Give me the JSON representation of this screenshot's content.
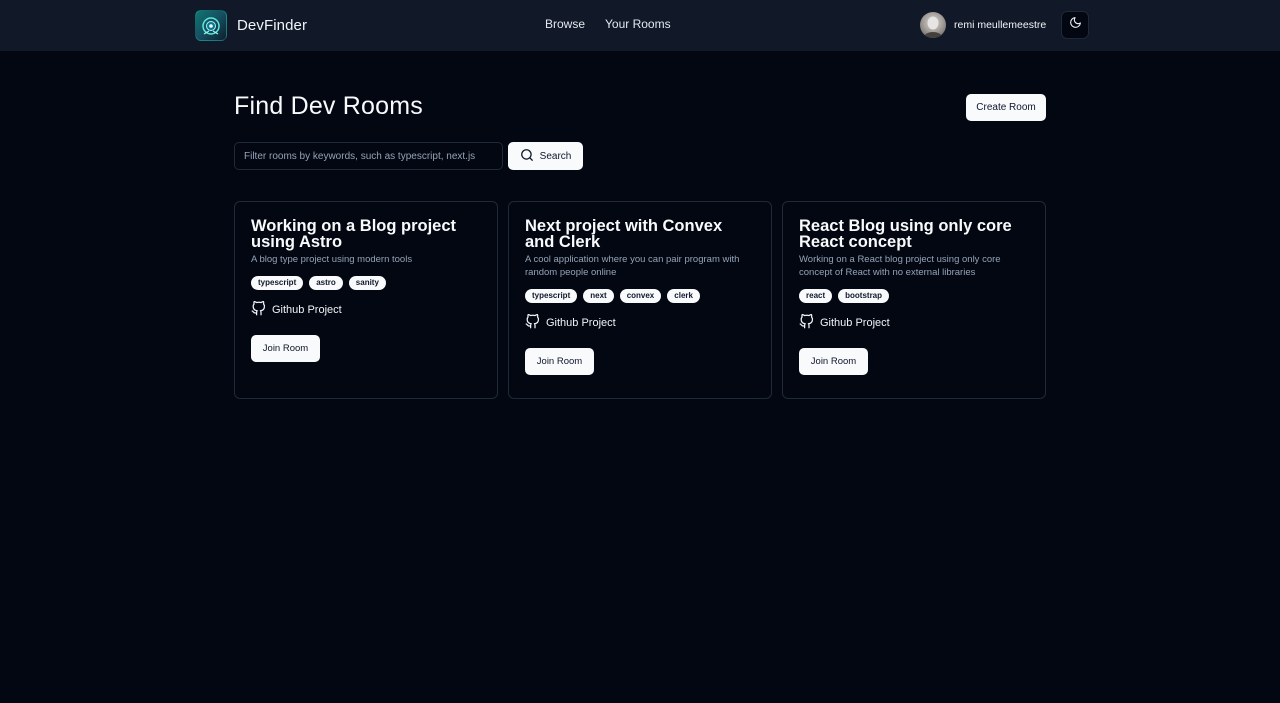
{
  "header": {
    "brand": "DevFinder",
    "nav": [
      {
        "label": "Browse"
      },
      {
        "label": "Your Rooms"
      }
    ],
    "user_name": "remi meullemeestre"
  },
  "main": {
    "title": "Find Dev Rooms",
    "create_label": "Create Room",
    "search_placeholder": "Filter rooms by keywords, such as typescript, next.js",
    "search_value": "",
    "search_label": "Search"
  },
  "rooms": [
    {
      "title": "Working on a Blog project using Astro",
      "description": "A blog type project using modern tools",
      "tags": [
        "typescript",
        "astro",
        "sanity"
      ],
      "link_label": "Github Project",
      "join_label": "Join Room"
    },
    {
      "title": "Next project with Convex and Clerk",
      "description": "A cool application where you can pair program with random people online",
      "tags": [
        "typescript",
        "next",
        "convex",
        "clerk"
      ],
      "link_label": "Github Project",
      "join_label": "Join Room"
    },
    {
      "title": "React Blog using only core React concept",
      "description": "Working on a React blog project using only core concept of React with no external libraries",
      "tags": [
        "react",
        "bootstrap"
      ],
      "link_label": "Github Project",
      "join_label": "Join Room"
    }
  ],
  "icons": {
    "logo": "devfinder-logo-icon",
    "theme_toggle": "moon-icon",
    "search": "search-icon",
    "github": "github-icon"
  },
  "colors": {
    "background": "#030711",
    "header": "#111827",
    "button": "#f8fafc",
    "border": "#1f2937"
  }
}
